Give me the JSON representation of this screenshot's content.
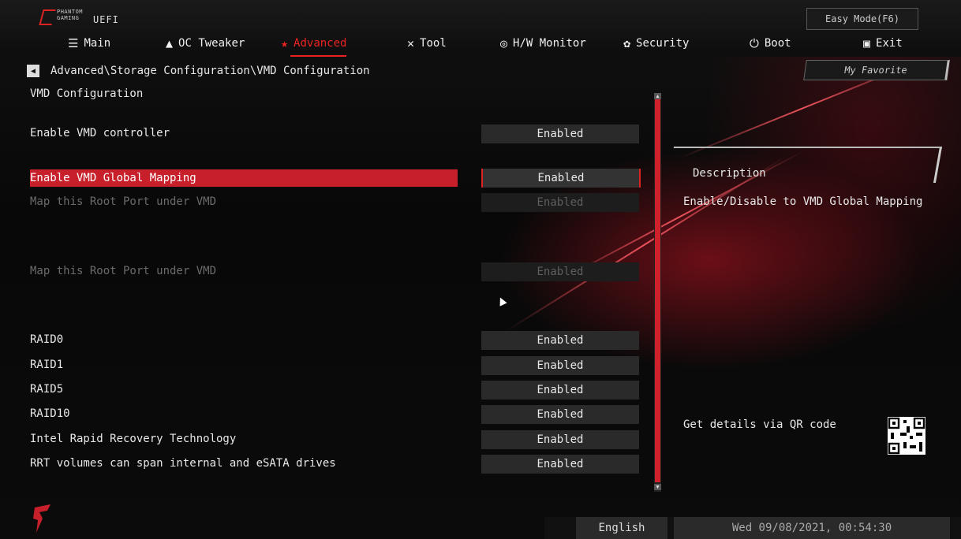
{
  "logo": {
    "brand_line1": "PHANTOM",
    "brand_line2": "GAMING",
    "uefi": "UEFI"
  },
  "easy_mode": "Easy Mode(F6)",
  "nav": {
    "tabs": [
      {
        "label": "Main",
        "icon": "list-icon"
      },
      {
        "label": "OC Tweaker",
        "icon": "rocket-icon"
      },
      {
        "label": "Advanced",
        "icon": "star-icon",
        "active": true
      },
      {
        "label": "Tool",
        "icon": "tools-icon"
      },
      {
        "label": "H/W Monitor",
        "icon": "monitor-icon"
      },
      {
        "label": "Security",
        "icon": "shield-icon"
      },
      {
        "label": "Boot",
        "icon": "power-icon"
      },
      {
        "label": "Exit",
        "icon": "exit-icon"
      }
    ]
  },
  "breadcrumb": "Advanced\\Storage Configuration\\VMD Configuration",
  "my_favorite": "My Favorite",
  "page_title": "VMD Configuration",
  "settings": [
    {
      "label": "Enable VMD controller",
      "value": "Enabled",
      "state": "normal"
    },
    {
      "label": "Enable VMD Global Mapping",
      "value": "Enabled",
      "state": "selected"
    },
    {
      "label": "Map this Root Port under VMD",
      "value": "Enabled",
      "state": "disabled"
    },
    {
      "label": "Map this Root Port under VMD",
      "value": "Enabled",
      "state": "disabled"
    },
    {
      "label": "RAID0",
      "value": "Enabled",
      "state": "normal"
    },
    {
      "label": "RAID1",
      "value": "Enabled",
      "state": "normal"
    },
    {
      "label": "RAID5",
      "value": "Enabled",
      "state": "normal"
    },
    {
      "label": "RAID10",
      "value": "Enabled",
      "state": "normal"
    },
    {
      "label": "Intel Rapid Recovery Technology",
      "value": "Enabled",
      "state": "normal"
    },
    {
      "label": "RRT volumes can span internal and eSATA drives",
      "value": "Enabled",
      "state": "normal"
    }
  ],
  "description": {
    "title": "Description",
    "text": "Enable/Disable to VMD Global Mapping",
    "qr_text": "Get details via QR code"
  },
  "footer": {
    "language": "English",
    "datetime": "Wed 09/08/2021, 00:54:30"
  },
  "colors": {
    "accent": "#d0202c",
    "background": "#0b0b0b",
    "text": "#e8e8e8",
    "dim": "#6b6b6b"
  }
}
